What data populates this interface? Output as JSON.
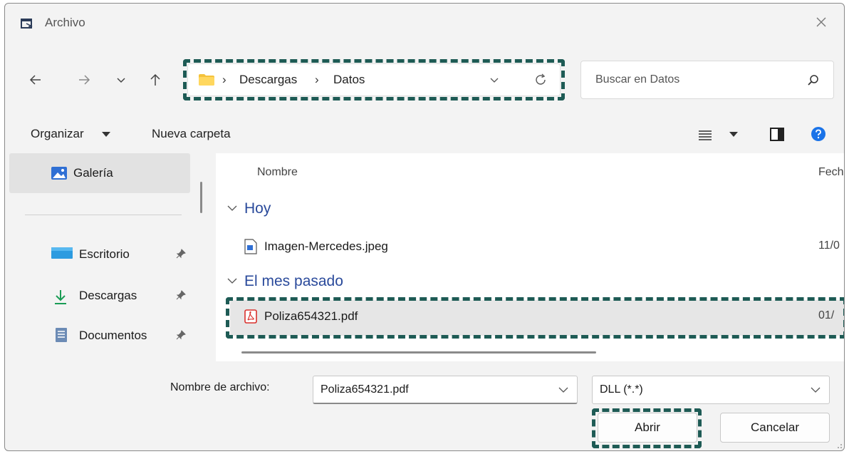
{
  "window": {
    "title": "Archivo",
    "close_icon": "close-icon"
  },
  "nav": {
    "back_icon": "arrow-left-icon",
    "forward_icon": "arrow-right-icon",
    "recent_icon": "chevron-down-icon",
    "up_icon": "arrow-up-icon"
  },
  "address": {
    "folder_icon": "folder-icon",
    "breadcrumbs": [
      "Descargas",
      "Datos"
    ],
    "separator": "›"
  },
  "search": {
    "placeholder": "Buscar en Datos"
  },
  "toolbar": {
    "organize": "Organizar",
    "new_folder": "Nueva carpeta"
  },
  "sidebar": {
    "items": [
      {
        "label": "Galería",
        "icon": "gallery-icon",
        "selected": true
      },
      {
        "label": "Escritorio",
        "icon": "desktop-icon",
        "pinned": true
      },
      {
        "label": "Descargas",
        "icon": "download-icon",
        "pinned": true
      },
      {
        "label": "Documentos",
        "icon": "documents-icon",
        "pinned": true
      }
    ]
  },
  "file_list": {
    "columns": [
      "Nombre",
      "Fech"
    ],
    "groups": [
      {
        "label": "Hoy",
        "files": [
          {
            "name": "Imagen-Mercedes.jpeg",
            "date": "11/0",
            "icon": "image-file-icon"
          }
        ]
      },
      {
        "label": "El mes pasado",
        "files": [
          {
            "name": "Poliza654321.pdf",
            "date": "01/",
            "icon": "pdf-file-icon",
            "selected": true
          }
        ]
      }
    ]
  },
  "footer": {
    "filename_label": "Nombre de archivo:",
    "filename_value": "Poliza654321.pdf",
    "filetype_value": "DLL (*.*)",
    "open_button": "Abrir",
    "cancel_button": "Cancelar"
  },
  "colors": {
    "highlight_dash": "#1e5b55",
    "group_header": "#2a4a9b",
    "help_blue": "#1a73e8"
  }
}
